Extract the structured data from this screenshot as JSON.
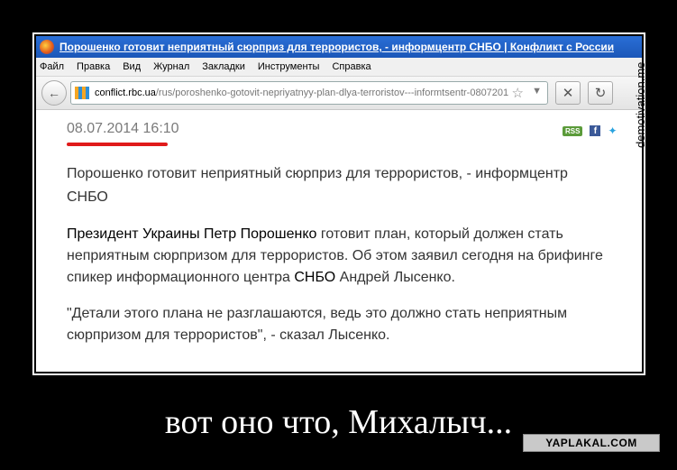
{
  "window": {
    "title": "Порошенко готовит неприятный сюрприз для террористов, - информцентр СНБО | Конфликт с России"
  },
  "menubar": {
    "items": [
      "Файл",
      "Правка",
      "Вид",
      "Журнал",
      "Закладки",
      "Инструменты",
      "Справка"
    ]
  },
  "navbar": {
    "url_domain": "conflict.rbc.ua",
    "url_rest": "/rus/poroshenko-gotovit-nepriyatnyy-plan-dlya-terroristov---informtsentr-0807201"
  },
  "article": {
    "date": "08.07.2014 16:10",
    "rss_label": "RSS",
    "headline": "Порошенко готовит неприятный сюрприз для террористов, - информцентр СНБО",
    "para1_lead": "Президент Украины Петр Порошенко",
    "para1_middle": " готовит план, который должен стать неприятным сюрпризом для террористов. Об этом заявил сегодня на брифинге спикер информационного центра ",
    "para1_snbo": "СНБО",
    "para1_end": " Андрей Лысенко.",
    "para2": "\"Детали этого плана не разглашаются, ведь это должно стать неприятным сюрпризом для террористов\", - сказал Лысенко."
  },
  "poster": {
    "caption": "вот оно что, Михалыч...",
    "watermark": "demotivation.me",
    "logo": "YAPLAKAL.COM"
  },
  "colors": {
    "date_underline": "#e01b1b",
    "titlebar": "#2a6fd6"
  }
}
